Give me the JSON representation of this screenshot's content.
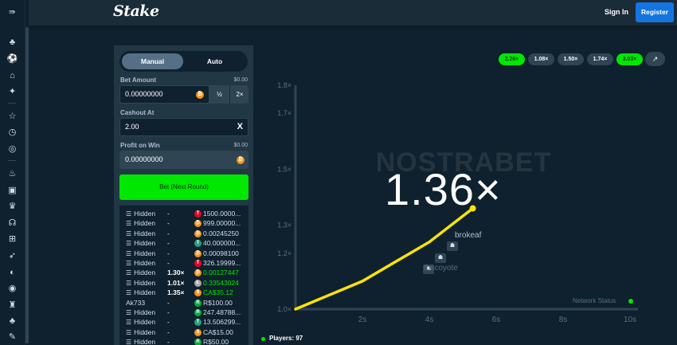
{
  "header": {
    "logo": "Stake",
    "signin_label": "Sign In",
    "register_label": "Register"
  },
  "sidebar": {
    "icons": [
      "menu-collapse-icon",
      "casino-icon",
      "sports-icon",
      "home-icon",
      "promotions-icon",
      "star-icon",
      "history-icon",
      "target-icon",
      "fire-icon",
      "bookmark-icon",
      "trophy-icon",
      "support-icon",
      "gift-icon",
      "rocket-icon",
      "flame-icon",
      "shield-icon",
      "globe-icon",
      "settings-icon"
    ]
  },
  "panel": {
    "tabs": {
      "manual": "Manual",
      "auto": "Auto"
    },
    "bet_amount": {
      "label": "Bet Amount",
      "usd": "$0.00",
      "value": "0.00000000",
      "half": "½",
      "double": "2×"
    },
    "cashout": {
      "label": "Cashout At",
      "value": "2.00",
      "clear": "X"
    },
    "profit": {
      "label": "Profit on Win",
      "usd": "$0.00",
      "value": "0.00000000"
    },
    "bet_button": "Bet (Next Round)",
    "bets": [
      {
        "user": "Hidden",
        "hidden": true,
        "mult": "-",
        "amount": "1500.0000...",
        "coin": "trx",
        "win": false
      },
      {
        "user": "Hidden",
        "hidden": true,
        "mult": "-",
        "amount": "999.00000...",
        "coin": "btc",
        "win": false
      },
      {
        "user": "Hidden",
        "hidden": true,
        "mult": "-",
        "amount": "0.00245250",
        "coin": "btc",
        "win": false
      },
      {
        "user": "Hidden",
        "hidden": true,
        "mult": "-",
        "amount": "40.000000...",
        "coin": "usdt",
        "win": false
      },
      {
        "user": "Hidden",
        "hidden": true,
        "mult": "-",
        "amount": "0.00098100",
        "coin": "btc",
        "win": false
      },
      {
        "user": "Hidden",
        "hidden": true,
        "mult": "-",
        "amount": "326.19999...",
        "coin": "trx",
        "win": false
      },
      {
        "user": "Hidden",
        "hidden": true,
        "mult": "1.30×",
        "amount": "0.00127447",
        "coin": "btc",
        "win": true
      },
      {
        "user": "Hidden",
        "hidden": true,
        "mult": "1.01×",
        "amount": "0.33543024",
        "coin": "ltc",
        "win": true
      },
      {
        "user": "Hidden",
        "hidden": true,
        "mult": "1.35×",
        "amount": "CA$35.12",
        "coin": "cad",
        "win": true
      },
      {
        "user": "Ak733",
        "hidden": false,
        "mult": "-",
        "amount": "R$100.00",
        "coin": "brl",
        "win": false
      },
      {
        "user": "Hidden",
        "hidden": true,
        "mult": "-",
        "amount": "247.48788...",
        "coin": "brl",
        "win": false
      },
      {
        "user": "Hidden",
        "hidden": true,
        "mult": "-",
        "amount": "13.506299...",
        "coin": "usdt",
        "win": false
      },
      {
        "user": "Hidden",
        "hidden": true,
        "mult": "-",
        "amount": "CA$15.00",
        "coin": "cad",
        "win": false
      },
      {
        "user": "Hidden",
        "hidden": true,
        "mult": "-",
        "amount": "R$50.00",
        "coin": "brl",
        "win": false
      }
    ]
  },
  "graph": {
    "history": [
      {
        "label": "2.26×",
        "green": true
      },
      {
        "label": "1.08×",
        "green": false
      },
      {
        "label": "1.50×",
        "green": false
      },
      {
        "label": "1.74×",
        "green": false
      },
      {
        "label": "3.03×",
        "green": true
      }
    ],
    "multiplier": "1.36×",
    "watermark": "NOSTRABET",
    "players_on_graph": [
      "brokeaf",
      "tbscoyote"
    ],
    "network_status": "Network Status",
    "players_count": "Players: 97"
  },
  "colors": {
    "accent_green": "#00e701",
    "brand_blue": "#1475e1",
    "curve": "#ffe500",
    "bg": "#0f212e",
    "panel": "#213743"
  },
  "chart_data": {
    "type": "line",
    "title": "",
    "xlabel": "",
    "ylabel": "",
    "x_ticks": [
      "2s",
      "4s",
      "6s",
      "8s",
      "10s"
    ],
    "y_ticks": [
      "1.0×",
      "1.2×",
      "1.3×",
      "1.5×",
      "1.7×",
      "1.8×"
    ],
    "xlim": [
      0,
      10
    ],
    "ylim": [
      1.0,
      1.8
    ],
    "series": [
      {
        "x": [
          0,
          1,
          2,
          3,
          4,
          5.3
        ],
        "y": [
          1.0,
          1.05,
          1.1,
          1.17,
          1.24,
          1.36
        ]
      }
    ],
    "current": {
      "x": 5.3,
      "y": 1.36
    }
  }
}
